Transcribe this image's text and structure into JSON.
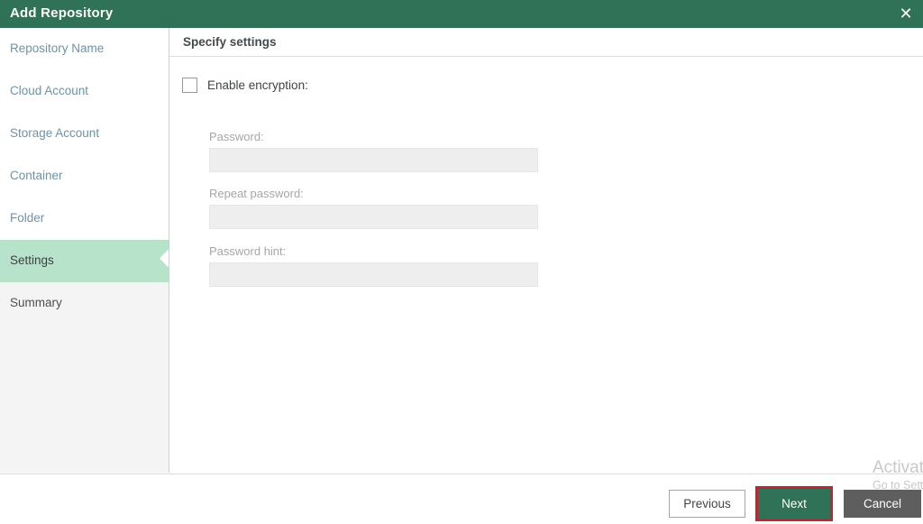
{
  "window": {
    "title": "Add Repository",
    "close_icon": "close-icon"
  },
  "sidebar": {
    "items": [
      {
        "label": "Repository Name",
        "state": "done"
      },
      {
        "label": "Cloud Account",
        "state": "done"
      },
      {
        "label": "Storage Account",
        "state": "done"
      },
      {
        "label": "Container",
        "state": "done"
      },
      {
        "label": "Folder",
        "state": "done"
      },
      {
        "label": "Settings",
        "state": "active"
      },
      {
        "label": "Summary",
        "state": "future"
      }
    ]
  },
  "content": {
    "title": "Specify settings",
    "enable_encryption": {
      "label": "Enable encryption:",
      "checked": false
    },
    "fields": [
      {
        "label": "Password:",
        "value": "",
        "placeholder": "",
        "disabled": true
      },
      {
        "label": "Repeat password:",
        "value": "",
        "placeholder": "",
        "disabled": true
      },
      {
        "label": "Password hint:",
        "value": "",
        "placeholder": "",
        "disabled": true
      }
    ]
  },
  "footer": {
    "previous_label": "Previous",
    "next_label": "Next",
    "cancel_label": "Cancel"
  },
  "watermark": {
    "line1": "Activate Windows",
    "line2": "Go to Settings to activate Windows"
  },
  "colors": {
    "title_bar_green": "#2f7257",
    "active_step_mint": "#b7e3ca",
    "step_link_blue": "#6f92a8",
    "next_button_green": "#2f7257",
    "highlight_red": "#b52b34",
    "cancel_gray": "#5e5e5e",
    "disabled_field_gray": "#eeeeee"
  }
}
